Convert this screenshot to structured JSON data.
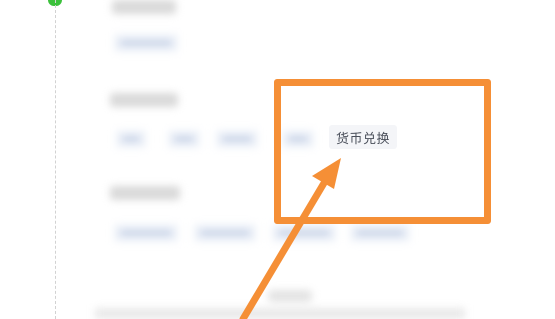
{
  "currency_exchange": {
    "label": "货币兑换"
  },
  "colors": {
    "highlight": "#f58f36",
    "chip_background": "#f4f5f8",
    "chip_text": "#4a4f5a",
    "indicator": "#3cc13c"
  },
  "annotations": {
    "highlight_box": "orange-rectangle",
    "pointer": "orange-arrow"
  }
}
